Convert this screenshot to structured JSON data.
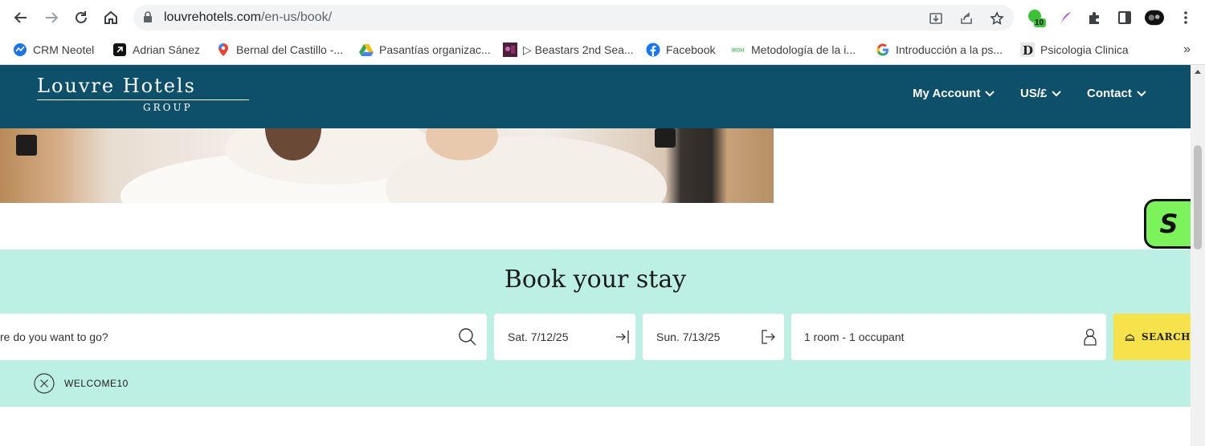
{
  "browser": {
    "url_host": "louvrehotels.com",
    "url_path": "/en-us/book/",
    "extension_badge": "10",
    "bookmarks": [
      {
        "label": "CRM Neotel",
        "icon": "crm-icon"
      },
      {
        "label": "Adrian Sánez",
        "icon": "app-icon"
      },
      {
        "label": "Bernal del Castillo -...",
        "icon": "maps-pin-icon"
      },
      {
        "label": "Pasantías organizac...",
        "icon": "drive-icon"
      },
      {
        "label": "▷ Beastars 2nd Sea...",
        "icon": "video-thumb-icon"
      },
      {
        "label": "Facebook",
        "icon": "facebook-icon"
      },
      {
        "label": "Metodología de la i...",
        "icon": "site-icon"
      },
      {
        "label": "Introducción a la ps...",
        "icon": "google-icon"
      },
      {
        "label": "Psicologia Clinica",
        "icon": "d-icon"
      }
    ],
    "bookmarks_more": "»"
  },
  "header": {
    "logo_main": "Louvre Hotels",
    "logo_sub": "GROUP",
    "nav": [
      {
        "label": "My Account"
      },
      {
        "label": "US/£"
      },
      {
        "label": "Contact"
      }
    ]
  },
  "widget": {
    "label": "S"
  },
  "booking": {
    "title": "Book your stay",
    "destination_placeholder": "re do you want to go?",
    "checkin": "Sat. 7/12/25",
    "checkout": "Sun. 7/13/25",
    "occupancy": "1 room - 1 occupant",
    "search_label": "SEARCH",
    "promo_code": "WELCOME10"
  },
  "colors": {
    "header_bg": "#0e4f6a",
    "booking_bg": "#bdf0e4",
    "search_btn": "#f6e24a",
    "widget_bg": "#7cf25b"
  }
}
